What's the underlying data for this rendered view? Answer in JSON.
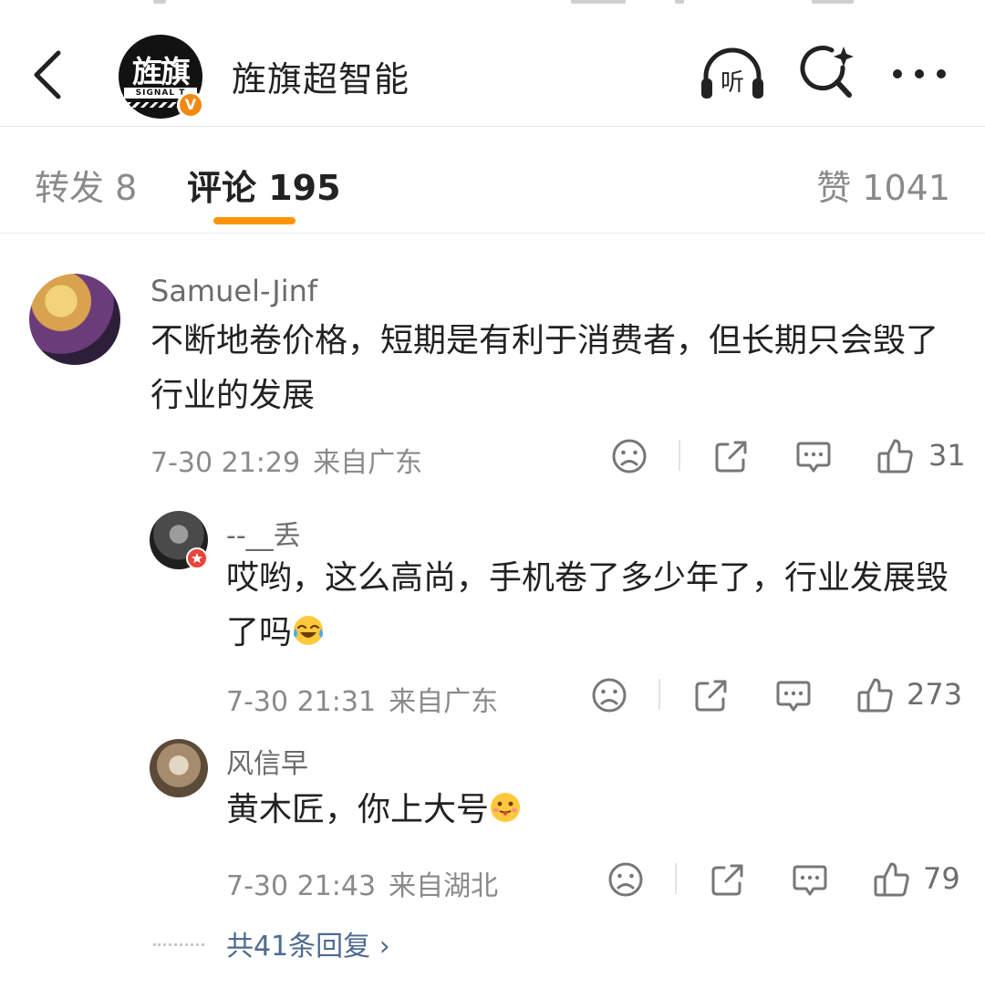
{
  "header": {
    "account_name": "旌旗超智能",
    "logo_text": "旌旗",
    "logo_subtext": "SIGNAL T",
    "verified_badge": "V",
    "back_icon": "chevron-left-icon",
    "listen_label": "听",
    "icons": [
      "chevron-left-icon",
      "headphones-listen-icon",
      "search-sparkle-icon",
      "more-dots-icon"
    ]
  },
  "tabs": [
    {
      "label": "转发 8",
      "active": false
    },
    {
      "label": "评论 195",
      "active": true
    },
    {
      "label": "赞 1041",
      "active": false
    }
  ],
  "colors": {
    "accent": "#ff9500",
    "link": "#4d6a91",
    "muted": "#8a8a8a",
    "badge": "#f28a12"
  },
  "comment": {
    "username": "Samuel-Jinf",
    "text": "不断地卷价格，短期是有利于消费者，但长期只会毁了行业的发展",
    "time": "7-30 21:29",
    "location": "来自广东",
    "likes": "31"
  },
  "replies": [
    {
      "username": "--__丢",
      "text": "哎哟，这么高尚，手机卷了多少年了，行业发展毁了吗",
      "emoji": "laugh-cry-emoji",
      "time": "7-30 21:31",
      "location": "来自广东",
      "likes": "273"
    },
    {
      "username": "风信早",
      "text": "黄木匠，你上大号",
      "emoji": "tongue-out-emoji",
      "time": "7-30 21:43",
      "location": "来自湖北",
      "likes": "79"
    }
  ],
  "more_replies": {
    "label": "共41条回复 ›"
  },
  "action_icons": [
    "dislike-face-icon",
    "share-icon",
    "reply-bubble-icon",
    "thumbs-up-icon"
  ]
}
